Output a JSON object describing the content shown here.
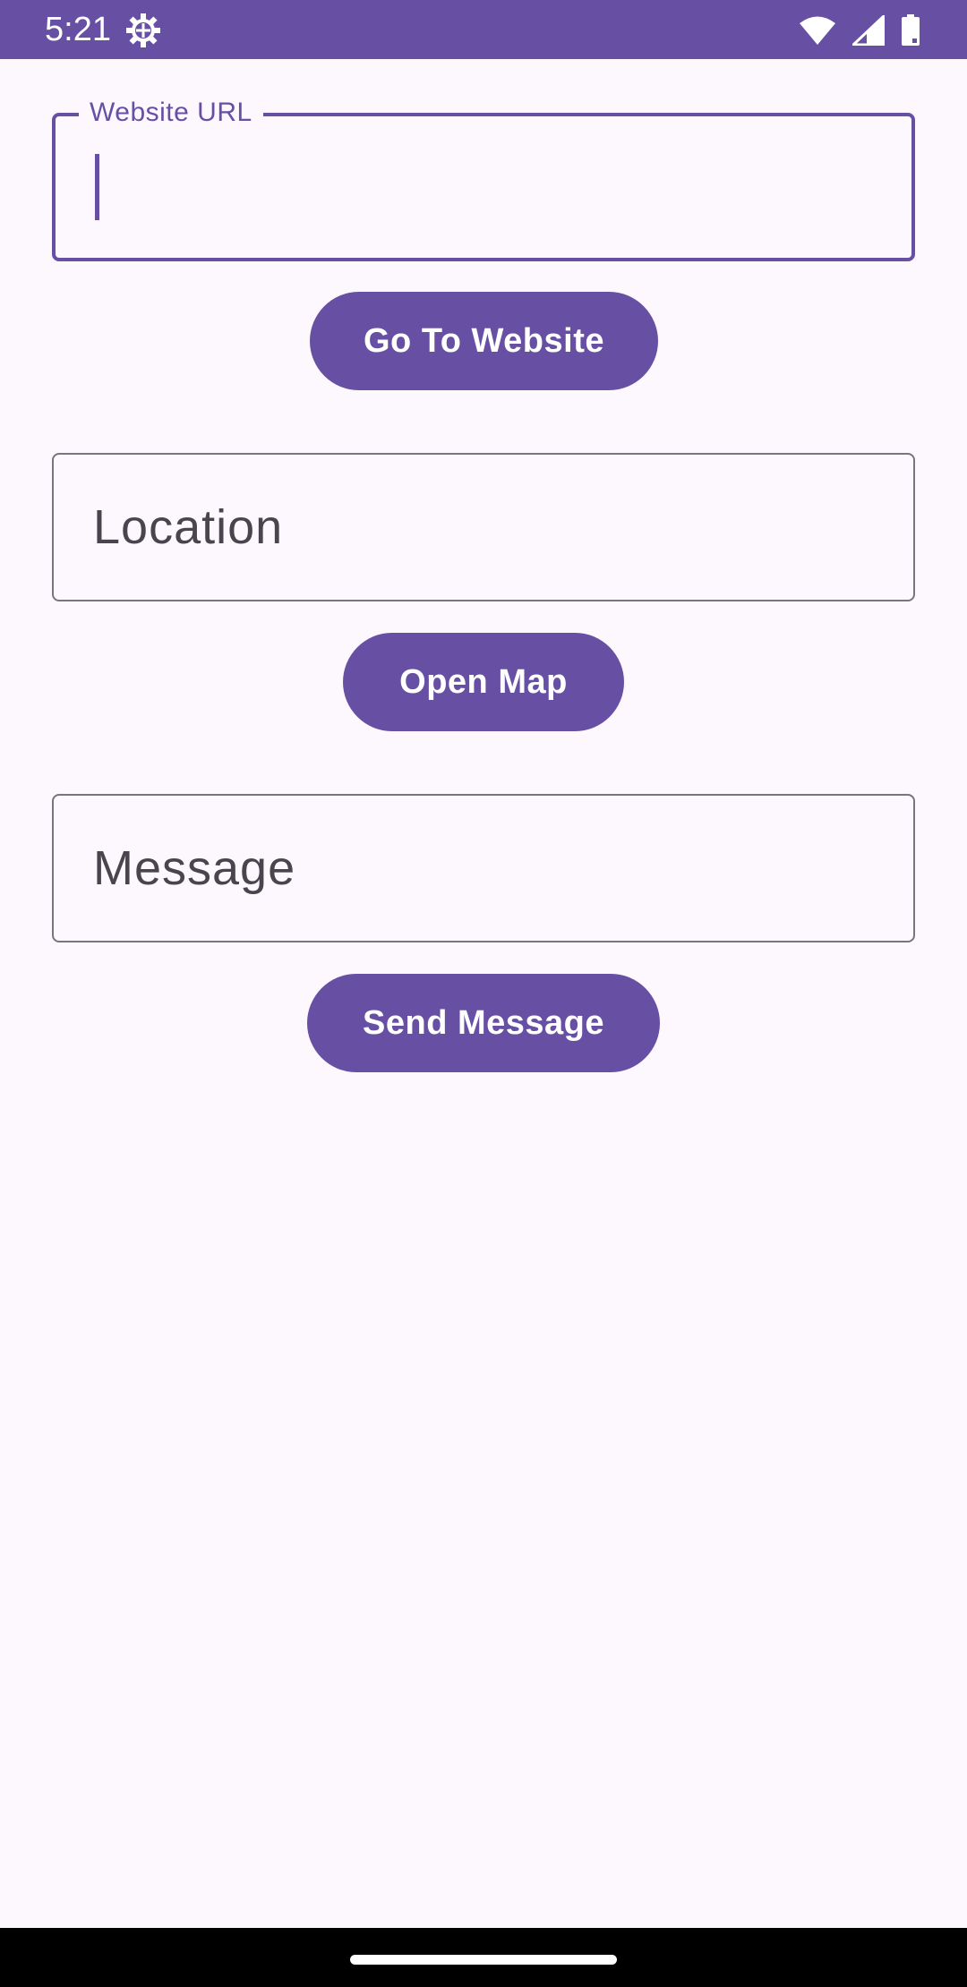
{
  "status_bar": {
    "time": "5:21",
    "icons": [
      "settings-gear-icon",
      "wifi-icon",
      "cell-signal-icon",
      "battery-icon"
    ]
  },
  "website": {
    "label": "Website URL",
    "value": "",
    "button_label": "Go To Website"
  },
  "location": {
    "placeholder": "Location",
    "button_label": "Open Map"
  },
  "message": {
    "placeholder": "Message",
    "button_label": "Send Message"
  },
  "colors": {
    "primary": "#6750A4",
    "background": "#FDF8FD",
    "outline": "#79747E",
    "on_surface_variant": "#49454F",
    "nav_bar": "#000000"
  }
}
